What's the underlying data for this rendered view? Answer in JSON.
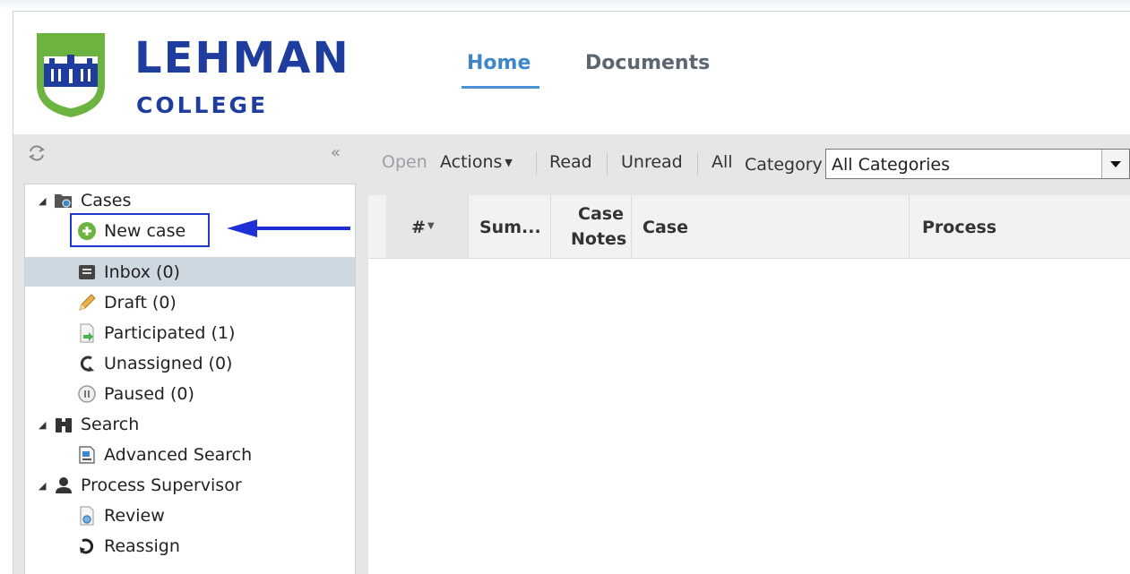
{
  "brand": {
    "line1": "LEHMAN",
    "line2": "COLLEGE"
  },
  "nav": {
    "tabs": [
      {
        "label": "Home",
        "active": true
      },
      {
        "label": "Documents",
        "active": false
      }
    ]
  },
  "sidebar": {
    "collapse_glyph": "«",
    "tree": {
      "cases": {
        "label": "Cases",
        "icon": "folder-search-icon"
      },
      "items": [
        {
          "label": "New case",
          "icon": "plus-circle-icon"
        },
        {
          "label": "Inbox (0)",
          "icon": "inbox-icon",
          "selected": true
        },
        {
          "label": "Draft (0)",
          "icon": "pencil-icon"
        },
        {
          "label": "Participated (1)",
          "icon": "document-arrow-icon"
        },
        {
          "label": "Unassigned (0)",
          "icon": "refresh-arrow-icon"
        },
        {
          "label": "Paused (0)",
          "icon": "pause-circle-icon"
        }
      ],
      "search": {
        "label": "Search",
        "icon": "binoculars-icon",
        "items": [
          {
            "label": "Advanced Search",
            "icon": "document-search-icon"
          }
        ]
      },
      "supervisor": {
        "label": "Process Supervisor",
        "icon": "user-icon",
        "items": [
          {
            "label": "Review",
            "icon": "document-magnifier-icon"
          },
          {
            "label": "Reassign",
            "icon": "reassign-arrow-icon"
          }
        ]
      }
    }
  },
  "toolbar": {
    "open": "Open",
    "actions": "Actions",
    "read": "Read",
    "unread": "Unread",
    "all": "All",
    "category_label": "Category",
    "category_value": "All Categories"
  },
  "grid": {
    "columns": [
      {
        "label": "#"
      },
      {
        "label": "Sum..."
      },
      {
        "label": "Case Notes",
        "line1": "Case",
        "line2": "Notes"
      },
      {
        "label": "Case"
      },
      {
        "label": "Process"
      }
    ]
  },
  "colors": {
    "brand_blue": "#1f3d9e",
    "brand_green": "#6cb33f",
    "accent": "#3e86c9",
    "highlight": "#2238c9"
  }
}
